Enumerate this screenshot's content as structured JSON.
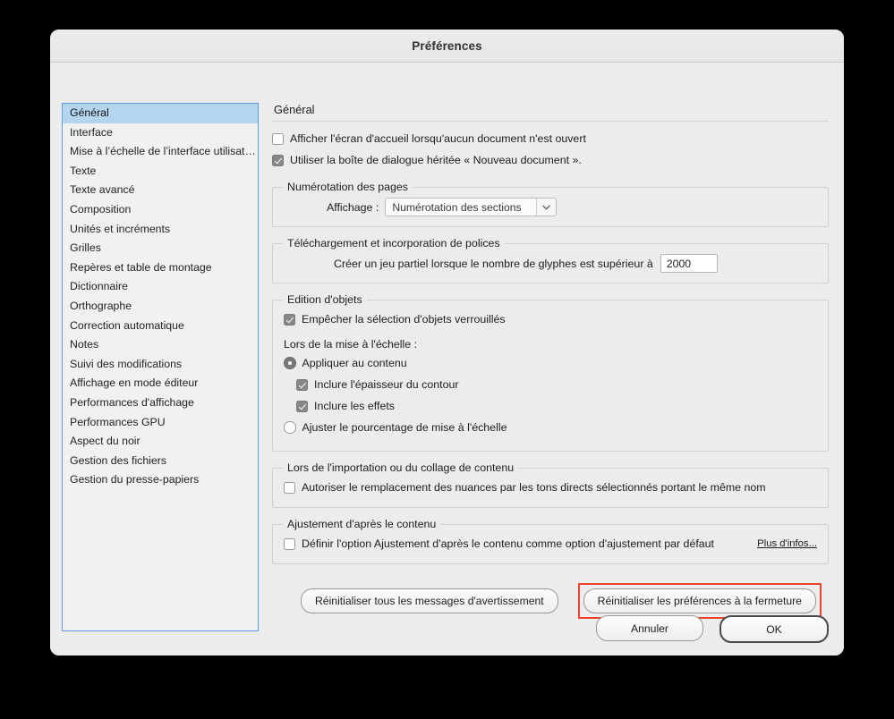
{
  "window": {
    "title": "Préférences"
  },
  "sidebar": {
    "items": [
      {
        "label": "Général",
        "selected": true
      },
      {
        "label": "Interface",
        "selected": false
      },
      {
        "label": "Mise à l’échelle de l’interface utilisateur",
        "selected": false
      },
      {
        "label": "Texte",
        "selected": false
      },
      {
        "label": "Texte avancé",
        "selected": false
      },
      {
        "label": "Composition",
        "selected": false
      },
      {
        "label": "Unités et incréments",
        "selected": false
      },
      {
        "label": "Grilles",
        "selected": false
      },
      {
        "label": "Repères et table de montage",
        "selected": false
      },
      {
        "label": "Dictionnaire",
        "selected": false
      },
      {
        "label": "Orthographe",
        "selected": false
      },
      {
        "label": "Correction automatique",
        "selected": false
      },
      {
        "label": "Notes",
        "selected": false
      },
      {
        "label": "Suivi des modifications",
        "selected": false
      },
      {
        "label": "Affichage en mode éditeur",
        "selected": false
      },
      {
        "label": "Performances d'affichage",
        "selected": false
      },
      {
        "label": "Performances GPU",
        "selected": false
      },
      {
        "label": "Aspect du noir",
        "selected": false
      },
      {
        "label": "Gestion des fichiers",
        "selected": false
      },
      {
        "label": "Gestion du presse-papiers",
        "selected": false
      }
    ]
  },
  "panel": {
    "title": "Général",
    "show_start_screen": {
      "label": "Afficher l'écran d'accueil lorsqu'aucun document n'est ouvert",
      "checked": false
    },
    "legacy_new_doc": {
      "label": "Utiliser la boîte de dialogue héritée « Nouveau document ».",
      "checked": true
    },
    "page_numbering": {
      "legend": "Numérotation des pages",
      "display_label": "Affichage :",
      "display_value": "Numérotation des sections",
      "chevron": "chevron-down-icon"
    },
    "font_download": {
      "legend": "Téléchargement et incorporation de polices",
      "subset_label": "Créer un jeu partiel lorsque le nombre de glyphes est supérieur à",
      "subset_value": "2000"
    },
    "object_editing": {
      "legend": "Edition d'objets",
      "prevent_locked": {
        "label": "Empêcher la sélection d'objets verrouillés",
        "checked": true
      },
      "scaling_label": "Lors de la mise à l'échelle :",
      "apply_to_content": {
        "label": "Appliquer au contenu",
        "selected": true
      },
      "include_stroke": {
        "label": "Inclure l'épaisseur du contour",
        "checked": true
      },
      "include_effects": {
        "label": "Inclure les effets",
        "checked": true
      },
      "adjust_percentage": {
        "label": "Ajuster le pourcentage de mise à l'échelle",
        "selected": false
      }
    },
    "import_paste": {
      "legend": "Lors de l'importation ou du collage de contenu",
      "allow_swatch_replace": {
        "label": "Autoriser le remplacement des nuances par les tons directs sélectionnés portant le même nom",
        "checked": false
      }
    },
    "content_fitting": {
      "legend": "Ajustement d'après le contenu",
      "set_default": {
        "label": "Définir l'option Ajustement d'après le contenu comme option d'ajustement par défaut",
        "checked": false
      },
      "more_info": "Plus d'infos..."
    },
    "reset_all_warnings": "Réinitialiser tous les messages d'avertissement",
    "reset_prefs_on_quit": "Réinitialiser les préférences à la fermeture"
  },
  "footer": {
    "cancel": "Annuler",
    "ok": "OK"
  },
  "colors": {
    "highlight_box": "#ef4028",
    "selection_blue": "#b4d5f0",
    "list_border": "#5d9cec"
  }
}
